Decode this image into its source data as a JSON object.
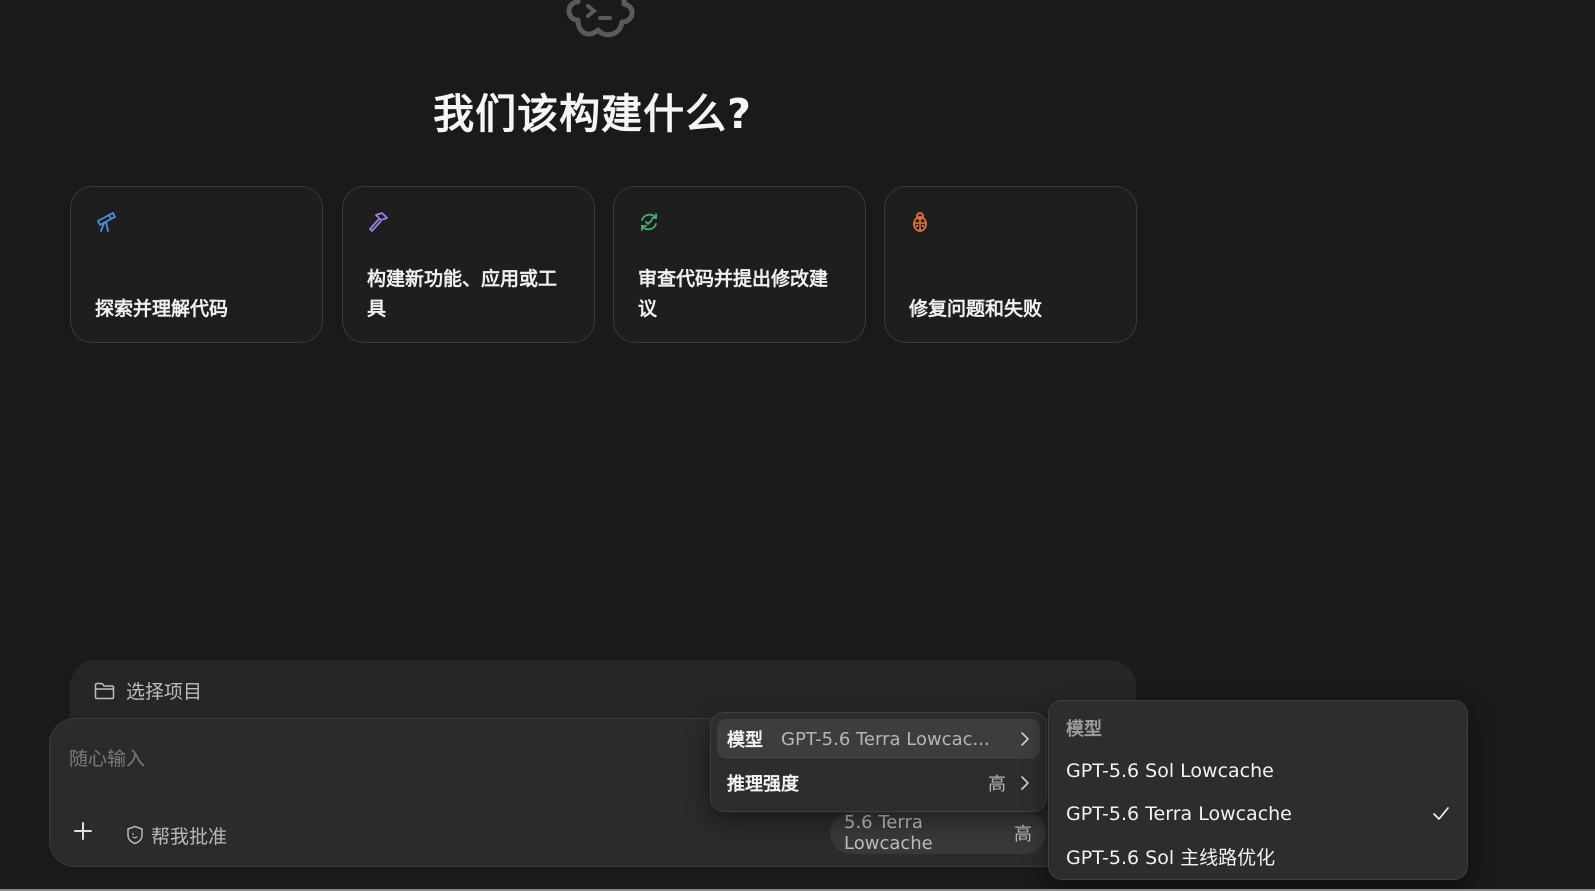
{
  "hero": {
    "title": "我们该构建什么?",
    "logo_icon": "codex-cloud-icon"
  },
  "suggestions": [
    {
      "icon": "telescope-icon",
      "label": "探索并理解代码",
      "color": "#4a90e2"
    },
    {
      "icon": "hammer-icon",
      "label": "构建新功能、应用或工具",
      "color": "#9b7ee8"
    },
    {
      "icon": "review-cycle-icon",
      "label": "审查代码并提出修改建议",
      "color": "#3cb371"
    },
    {
      "icon": "bug-icon",
      "label": "修复问题和失败",
      "color": "#e8743b"
    }
  ],
  "project": {
    "label": "选择项目",
    "icon": "folder-icon"
  },
  "composer": {
    "placeholder": "随心输入",
    "approve_label": "帮我批准",
    "model_chip": "5.6 Terra Lowcache",
    "effort_chip": "高"
  },
  "settings_menu": {
    "model_key": "模型",
    "model_value": "GPT-5.6 Terra Lowcac...",
    "effort_key": "推理强度",
    "effort_value": "高"
  },
  "model_menu": {
    "header": "模型",
    "options": [
      {
        "label": "GPT-5.6 Sol Lowcache",
        "selected": false
      },
      {
        "label": "GPT-5.6 Terra Lowcache",
        "selected": true
      },
      {
        "label": "GPT-5.6 Sol 主线路优化",
        "selected": false
      }
    ]
  }
}
